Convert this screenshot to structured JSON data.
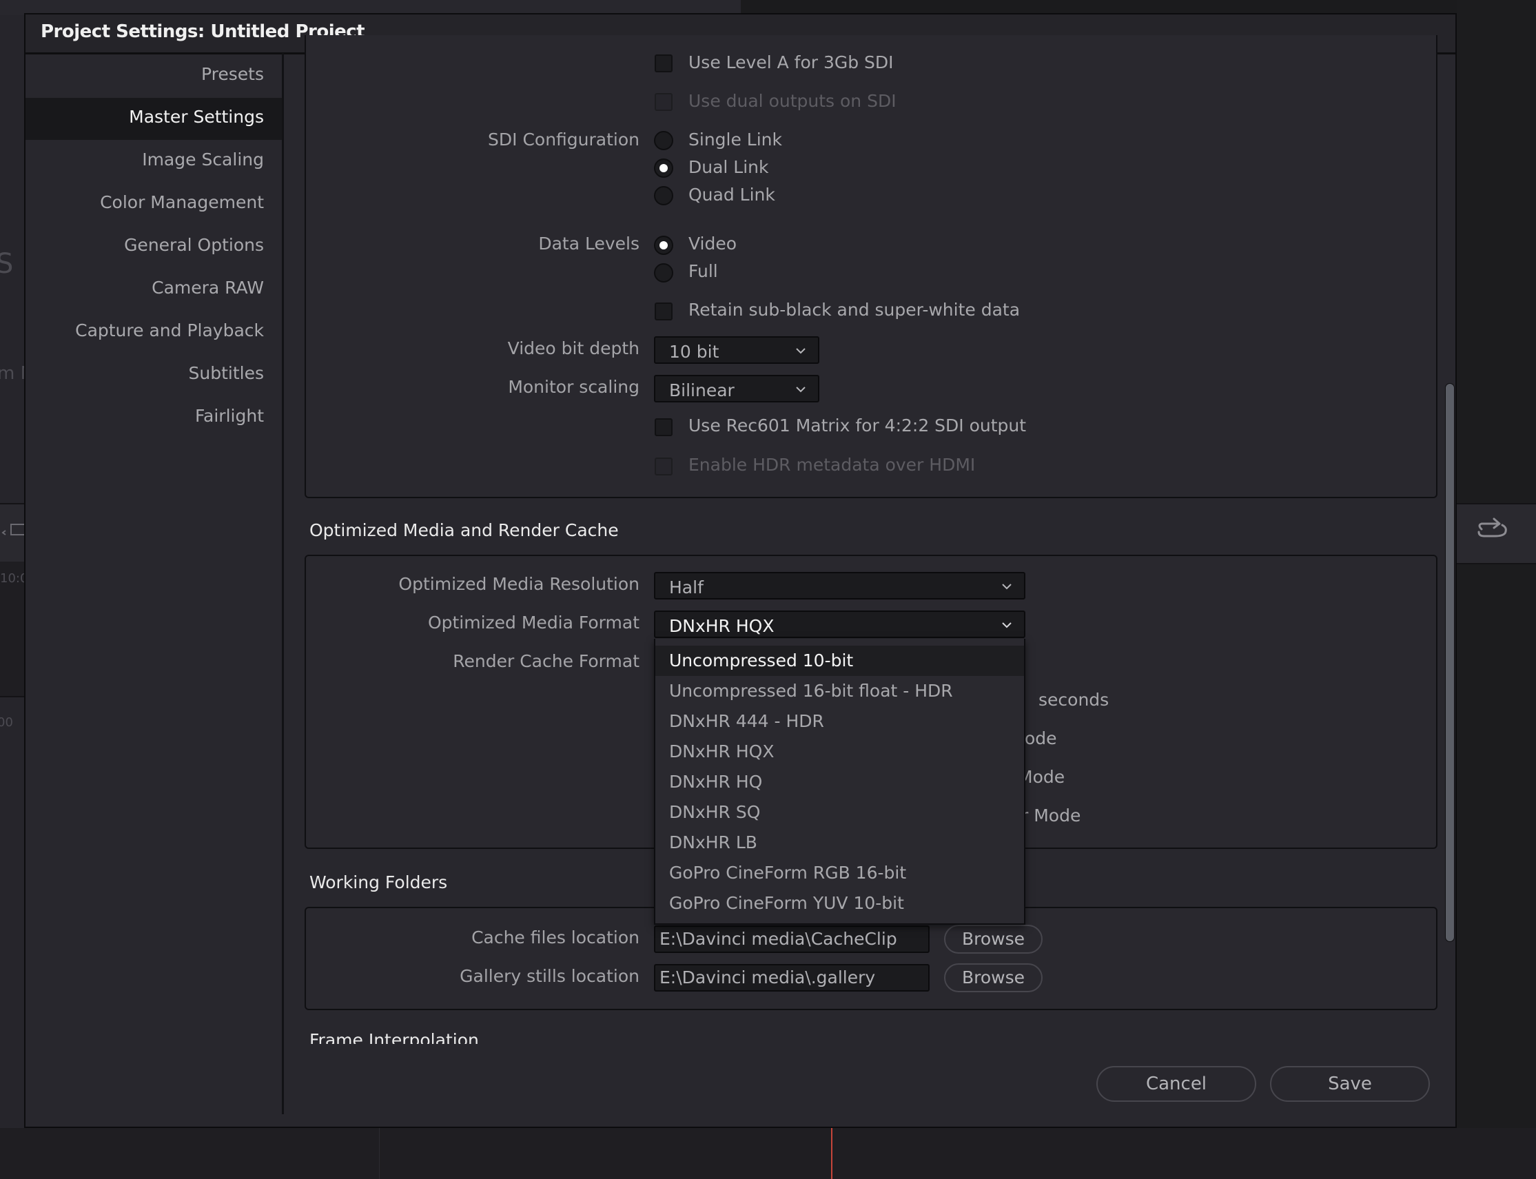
{
  "background_app": {
    "fragment_letter": "S",
    "fragment_text": "m N",
    "timecode_fragment": "10:0",
    "ruler_fragment": "00"
  },
  "dialog": {
    "title": "Project Settings:  Untitled Project",
    "sidebar": {
      "items": [
        {
          "label": "Presets",
          "active": false
        },
        {
          "label": "Master Settings",
          "active": true
        },
        {
          "label": "Image Scaling",
          "active": false
        },
        {
          "label": "Color Management",
          "active": false
        },
        {
          "label": "General Options",
          "active": false
        },
        {
          "label": "Camera RAW",
          "active": false
        },
        {
          "label": "Capture and Playback",
          "active": false
        },
        {
          "label": "Subtitles",
          "active": false
        },
        {
          "label": "Fairlight",
          "active": false
        }
      ]
    },
    "video_monitoring": {
      "use_level_a": {
        "label": "Use Level A for 3Gb SDI",
        "checked": false,
        "enabled": true
      },
      "dual_outputs": {
        "label": "Use dual outputs on SDI",
        "checked": false,
        "enabled": false
      },
      "sdi_configuration": {
        "label": "SDI Configuration",
        "options": [
          "Single Link",
          "Dual Link",
          "Quad Link"
        ],
        "selected": "Dual Link"
      },
      "data_levels": {
        "label": "Data Levels",
        "options": [
          "Video",
          "Full"
        ],
        "selected": "Video"
      },
      "retain_sub_black": {
        "label": "Retain sub-black and super-white data",
        "checked": false,
        "enabled": true
      },
      "video_bit_depth": {
        "label": "Video bit depth",
        "value": "10 bit"
      },
      "monitor_scaling": {
        "label": "Monitor scaling",
        "value": "Bilinear"
      },
      "rec601": {
        "label": "Use Rec601 Matrix for 4:2:2 SDI output",
        "checked": false,
        "enabled": true
      },
      "hdr_metadata": {
        "label": "Enable HDR metadata over HDMI",
        "checked": false,
        "enabled": false
      }
    },
    "optimized_media": {
      "title": "Optimized Media and Render Cache",
      "resolution": {
        "label": "Optimized Media Resolution",
        "value": "Half"
      },
      "format": {
        "label": "Optimized Media Format",
        "value": "DNxHR HQX"
      },
      "render_cache_format": {
        "label": "Render Cache Format"
      },
      "partial_texts": [
        "seconds",
        "ode",
        "Mode",
        "r Mode"
      ],
      "format_dropdown": {
        "open": true,
        "highlighted": "Uncompressed 10-bit",
        "options": [
          "Uncompressed 10-bit",
          "Uncompressed 16-bit float - HDR",
          "DNxHR 444 - HDR",
          "DNxHR HQX",
          "DNxHR HQ",
          "DNxHR SQ",
          "DNxHR LB",
          "GoPro CineForm RGB 16-bit",
          "GoPro CineForm YUV 10-bit"
        ]
      }
    },
    "working_folders": {
      "title": "Working Folders",
      "cache_location": {
        "label": "Cache files location",
        "value": "E:\\Davinci media\\CacheClip",
        "browse_label": "Browse"
      },
      "gallery_location": {
        "label": "Gallery stills location",
        "value": "E:\\Davinci media\\.gallery",
        "browse_label": "Browse"
      }
    },
    "frame_interpolation": {
      "title": "Frame Interpolation"
    },
    "footer": {
      "cancel_label": "Cancel",
      "save_label": "Save"
    }
  },
  "colors": {
    "dialog_bg": "#28272d",
    "highlight_bg": "#18181b",
    "text_active": "#f2f2f2",
    "text_normal": "#a9a9ad",
    "text_disabled": "#5d5c62",
    "playhead": "#c6453a"
  }
}
